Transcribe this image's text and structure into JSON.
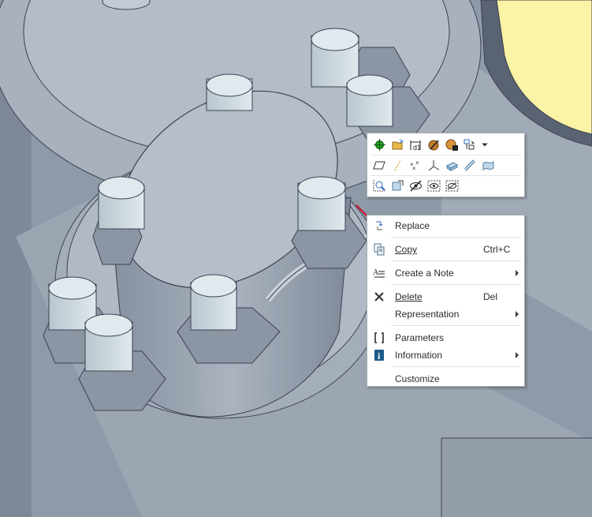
{
  "viewport": {
    "name": "3D model view",
    "colors": {
      "background": "#8f9aa8",
      "part_face": "#b7bfc9",
      "part_dark": "#8b95a3",
      "highlight": "#fbf3a5",
      "bolt_cap": "#dfe9ee"
    }
  },
  "mini_toolbar": {
    "rows": [
      [
        "datum-icon",
        "open-icon",
        "dimension-icon",
        "appearance-icon",
        "render-icon",
        "select-filter-icon",
        "dropdown-arrow-icon"
      ],
      [
        "plane-icon",
        "axis-icon",
        "point-icon",
        "csys-icon",
        "extrude-icon",
        "sweep-icon",
        "surface-icon"
      ],
      [
        "zoom-to-selected-icon",
        "reorient-icon",
        "hide-icon",
        "show-icon",
        "unhide-icon"
      ]
    ]
  },
  "context_menu": {
    "items": [
      {
        "label": "Replace",
        "icon": "replace-icon"
      },
      {
        "label": "Copy",
        "shortcut": "Ctrl+C",
        "icon": "copy-icon"
      },
      {
        "label": "Create a Note",
        "icon": "note-icon",
        "submenu": true
      },
      {
        "label": "Delete",
        "shortcut": "Del",
        "icon": "delete-icon"
      },
      {
        "label": "Representation",
        "submenu": true
      },
      {
        "label": "Parameters",
        "icon": "parameters-icon"
      },
      {
        "label": "Information",
        "icon": "information-icon",
        "submenu": true
      },
      {
        "label": "Customize"
      }
    ]
  }
}
